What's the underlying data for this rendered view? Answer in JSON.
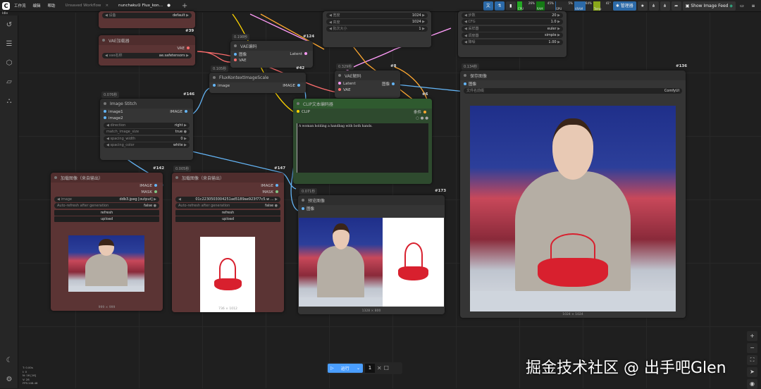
{
  "topbar": {
    "logo": "C",
    "menu": [
      "工作流",
      "编辑",
      "帮助"
    ],
    "tabs": [
      {
        "label": "Unsaved Workflow",
        "close": "×"
      },
      {
        "label": "nunchaku① Flux_kon…",
        "close": "●"
      }
    ],
    "add_tab": "+",
    "status": "Idle",
    "meters": [
      {
        "label": "CPU",
        "value": 26,
        "color": "#22aa22"
      },
      {
        "label": "RAM",
        "value": 45,
        "color": "#157a15"
      },
      {
        "label": "GPU",
        "value": 5,
        "color": "#2c6aa8"
      },
      {
        "label": "VRAM",
        "value": 64,
        "color": "#2c6aa8"
      },
      {
        "label": "Temp",
        "value": 41,
        "color": "#8aa81a"
      }
    ],
    "meter_text": [
      "26%",
      "45%",
      "5%",
      "64%",
      "41°"
    ],
    "manager_label": "管理器",
    "show_feed_label": "Show Image Feed"
  },
  "nodes": [
    {
      "key": "n39",
      "id": "",
      "widgets": [
        {
          "type": "combo",
          "label": "设备",
          "value": "default"
        }
      ]
    },
    {
      "key": "vaeload",
      "id": "#39",
      "title": "VAE加载器",
      "outputs": [
        {
          "label": "VAE",
          "color": "#ff6e6e"
        }
      ],
      "widgets": [
        {
          "type": "combo",
          "label": "vae名称",
          "value": "ae.safetensors"
        }
      ]
    },
    {
      "key": "vaeenc",
      "id": "#124",
      "time": "0.198秒",
      "title": "VAE编码",
      "inputs": [
        {
          "label": "图像",
          "color": "#64b5f6"
        },
        {
          "label": "VAE",
          "color": "#ff6e6e"
        }
      ],
      "outputs": [
        {
          "label": "Latent",
          "color": "#ff9cf9"
        }
      ]
    },
    {
      "key": "scale",
      "id": "#42",
      "time": "0.105秒",
      "title": "FluxKontextImageScale",
      "inputs": [
        {
          "label": "image",
          "color": "#64b5f6"
        }
      ],
      "outputs": [
        {
          "label": "IMAGE",
          "color": "#64b5f6"
        }
      ]
    },
    {
      "key": "stitch",
      "id": "#146",
      "time": "0.076秒",
      "title": "Image Stitch",
      "inputs": [
        {
          "label": "image1",
          "color": "#64b5f6"
        },
        {
          "label": "image2",
          "color": "#64b5f6"
        }
      ],
      "outputs": [
        {
          "label": "IMAGE",
          "color": "#64b5f6"
        }
      ],
      "widgets": [
        {
          "type": "combo",
          "label": "direction",
          "value": "right"
        },
        {
          "type": "toggle",
          "label": "match_image_size",
          "value": "true"
        },
        {
          "type": "combo",
          "label": "spacing_width",
          "value": "0"
        },
        {
          "type": "combo",
          "label": "spacing_color",
          "value": "white"
        }
      ]
    },
    {
      "key": "latent",
      "id": "",
      "widgets": [
        {
          "type": "combo",
          "label": "宽度",
          "value": "1024"
        },
        {
          "type": "combo",
          "label": "高度",
          "value": "1024"
        },
        {
          "type": "combo",
          "label": "批次大小",
          "value": "1"
        }
      ]
    },
    {
      "key": "sampler",
      "id": "",
      "widgets": [
        {
          "type": "combo",
          "label": "步数",
          "value": "20"
        },
        {
          "type": "combo",
          "label": "CFG",
          "value": "1.0"
        },
        {
          "type": "combo",
          "label": "采样器",
          "value": "euler"
        },
        {
          "type": "combo",
          "label": "调度器",
          "value": "simple"
        },
        {
          "type": "combo",
          "label": "降噪",
          "value": "1.00"
        }
      ]
    },
    {
      "key": "vaedec",
      "id": "#8",
      "time": "0.329秒",
      "title": "VAE解码",
      "inputs": [
        {
          "label": "Latent",
          "color": "#ff9cf9"
        },
        {
          "label": "VAE",
          "color": "#ff6e6e"
        }
      ],
      "outputs": [
        {
          "label": "图像",
          "color": "#64b5f6"
        }
      ]
    },
    {
      "key": "clip",
      "id": "#6",
      "title": "CLIP文本编码器",
      "inputs": [
        {
          "label": "CLIP",
          "color": "#ffd500"
        }
      ],
      "outputs": [
        {
          "label": "条件",
          "color": "#ffa931"
        }
      ],
      "text": "A woman holding a handbag with both hands."
    },
    {
      "key": "load142",
      "id": "#142",
      "title": "加载图像（来自输出）",
      "outputs": [
        {
          "label": "IMAGE",
          "color": "#64b5f6"
        },
        {
          "label": "MASK",
          "color": "#81c784"
        }
      ],
      "widgets": [
        {
          "type": "combo",
          "label": "image",
          "value": "ddb3.jpeg [output]"
        },
        {
          "type": "toggle",
          "label": "Auto-refresh after generation",
          "value": "false"
        },
        {
          "type": "btn",
          "label": "refresh"
        },
        {
          "type": "btn",
          "label": "upload"
        }
      ],
      "image": "anchor",
      "caption": "999 × 999"
    },
    {
      "key": "load147",
      "id": "#147",
      "time": "0.005秒",
      "title": "加载图像（来自输出）",
      "outputs": [
        {
          "label": "IMAGE",
          "color": "#64b5f6"
        },
        {
          "label": "MASK",
          "color": "#81c784"
        }
      ],
      "widgets": [
        {
          "type": "combo",
          "label": "",
          "value": "01c22305030042​51ad5189ae923f77c5.w ..."
        },
        {
          "type": "toggle",
          "label": "Auto-refresh after generation",
          "value": "false"
        },
        {
          "type": "btn",
          "label": "refresh"
        },
        {
          "type": "btn",
          "label": "upload"
        }
      ],
      "image": "bag",
      "caption": "736 × 1012"
    },
    {
      "key": "preview",
      "id": "#173",
      "time": "0.071秒",
      "title": "预览图像",
      "inputs": [
        {
          "label": "图像",
          "color": "#64b5f6"
        }
      ],
      "image": "combined",
      "caption": "1328 × 800"
    },
    {
      "key": "save",
      "id": "#136",
      "time": "0.134秒",
      "title": "保存图像",
      "inputs": [
        {
          "label": "图像",
          "color": "#64b5f6"
        }
      ],
      "widgets": [
        {
          "type": "text",
          "label": "文件名前缀",
          "value": "ComfyUI"
        }
      ],
      "image": "anchorbag",
      "caption": "1024 × 1024"
    }
  ],
  "runbar": {
    "run_label": "运行",
    "count": "1"
  },
  "stats": [
    "T: 0.00s",
    "I: 0",
    "N: 16 [16]",
    "V: 28",
    "FPS:108.48"
  ],
  "watermark": "掘金技术社区 @ 出手吧Glen"
}
